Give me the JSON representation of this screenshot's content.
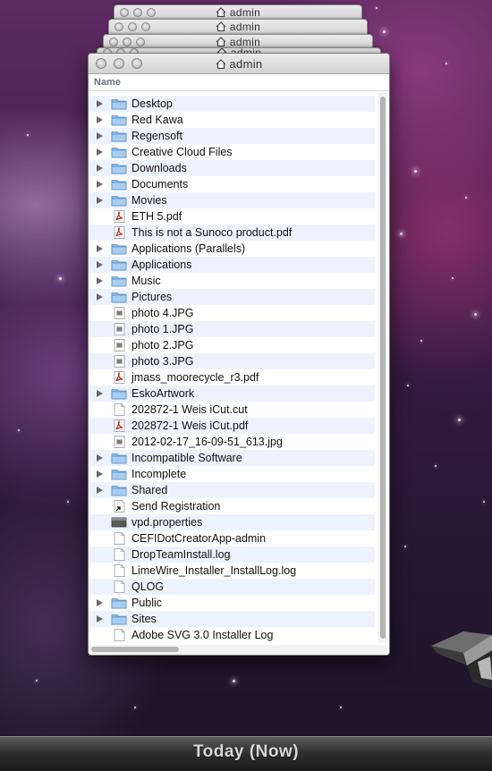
{
  "stack_windows": [
    {
      "title": "admin"
    },
    {
      "title": "admin"
    },
    {
      "title": "admin"
    },
    {
      "title": "admin"
    }
  ],
  "window": {
    "title": "admin",
    "column_header": "Name"
  },
  "files": [
    {
      "name": "Desktop",
      "kind": "folder",
      "expandable": true
    },
    {
      "name": "Red Kawa",
      "kind": "folder",
      "expandable": true
    },
    {
      "name": "Regensoft",
      "kind": "folder",
      "expandable": true
    },
    {
      "name": "Creative Cloud Files",
      "kind": "folder",
      "expandable": true
    },
    {
      "name": "Downloads",
      "kind": "folder",
      "expandable": true
    },
    {
      "name": "Documents",
      "kind": "folder",
      "expandable": true
    },
    {
      "name": "Movies",
      "kind": "folder",
      "expandable": true
    },
    {
      "name": "ETH 5.pdf",
      "kind": "pdf",
      "expandable": false
    },
    {
      "name": "This is not a Sunoco product.pdf",
      "kind": "pdf",
      "expandable": false
    },
    {
      "name": "Applications (Parallels)",
      "kind": "folder",
      "expandable": true
    },
    {
      "name": "Applications",
      "kind": "folder",
      "expandable": true
    },
    {
      "name": "Music",
      "kind": "folder",
      "expandable": true
    },
    {
      "name": "Pictures",
      "kind": "folder",
      "expandable": true
    },
    {
      "name": "photo 4.JPG",
      "kind": "image",
      "expandable": false
    },
    {
      "name": "photo 1.JPG",
      "kind": "image",
      "expandable": false
    },
    {
      "name": "photo 2.JPG",
      "kind": "image",
      "expandable": false
    },
    {
      "name": "photo 3.JPG",
      "kind": "image",
      "expandable": false
    },
    {
      "name": "jmass_moorecycle_r3.pdf",
      "kind": "pdf",
      "expandable": false
    },
    {
      "name": "EskoArtwork",
      "kind": "folder",
      "expandable": true
    },
    {
      "name": "202872-1 Weis iCut.cut",
      "kind": "document",
      "expandable": false
    },
    {
      "name": "202872-1 Weis iCut.pdf",
      "kind": "pdf",
      "expandable": false
    },
    {
      "name": "2012-02-17_16-09-51_613.jpg",
      "kind": "image",
      "expandable": false
    },
    {
      "name": "Incompatible Software",
      "kind": "folder",
      "expandable": true
    },
    {
      "name": "Incomplete",
      "kind": "folder",
      "expandable": true
    },
    {
      "name": "Shared",
      "kind": "folder",
      "expandable": true
    },
    {
      "name": "Send Registration",
      "kind": "alias",
      "expandable": false
    },
    {
      "name": "vpd.properties",
      "kind": "properties",
      "expandable": false
    },
    {
      "name": "CEFIDotCreatorApp-admin",
      "kind": "document",
      "expandable": false
    },
    {
      "name": "DropTeamInstall.log",
      "kind": "document",
      "expandable": false
    },
    {
      "name": "LimeWire_Installer_InstallLog.log",
      "kind": "document",
      "expandable": false
    },
    {
      "name": "QLOG",
      "kind": "document",
      "expandable": false
    },
    {
      "name": "Public",
      "kind": "folder",
      "expandable": true
    },
    {
      "name": "Sites",
      "kind": "folder",
      "expandable": true
    },
    {
      "name": "Adobe SVG 3.0 Installer Log",
      "kind": "document",
      "expandable": false
    }
  ],
  "bottom_bar": {
    "label": "Today (Now)"
  },
  "colors": {
    "alt_row": "#edf3fe",
    "folder": "#7fb2e6",
    "pdf_red": "#c22b2b"
  }
}
